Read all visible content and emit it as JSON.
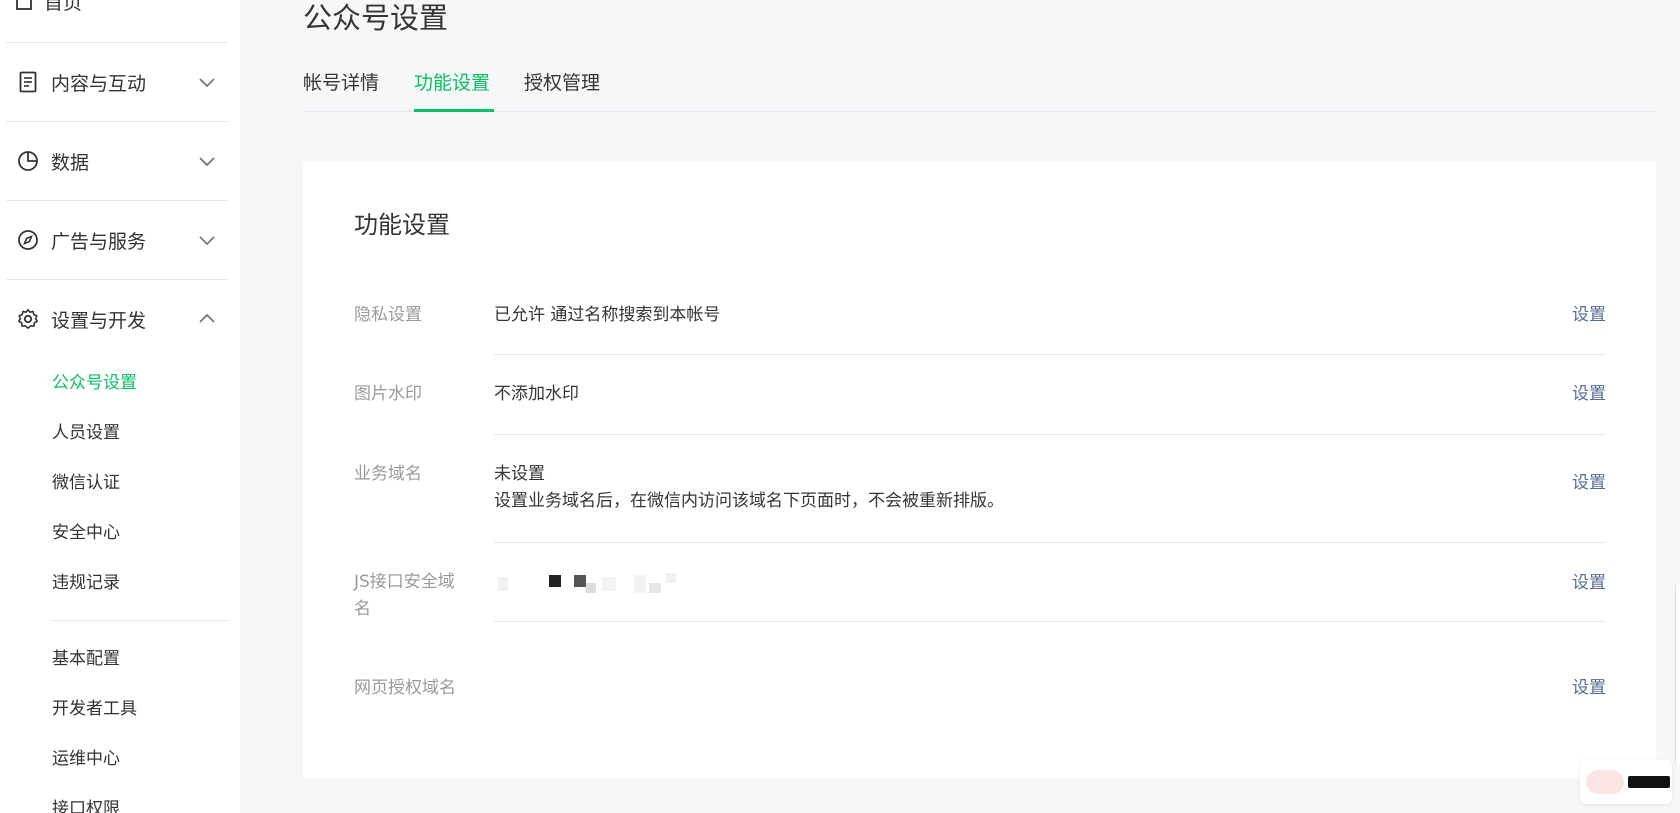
{
  "sidebar": {
    "top_cut_label": "首页",
    "groups": [
      {
        "label": "内容与互动",
        "icon": "document-icon",
        "expanded": false
      },
      {
        "label": "数据",
        "icon": "pie-chart-icon",
        "expanded": false
      },
      {
        "label": "广告与服务",
        "icon": "compass-icon",
        "expanded": false
      },
      {
        "label": "设置与开发",
        "icon": "gear-icon",
        "expanded": true
      }
    ],
    "sub_items": [
      {
        "label": "公众号设置",
        "active": true
      },
      {
        "label": "人员设置"
      },
      {
        "label": "微信认证"
      },
      {
        "label": "安全中心"
      },
      {
        "label": "违规记录"
      },
      {
        "label": "基本配置"
      },
      {
        "label": "开发者工具"
      },
      {
        "label": "运维中心"
      },
      {
        "label": "接口权限"
      }
    ]
  },
  "page_title": "公众号设置",
  "tabs": [
    {
      "label": "帐号详情"
    },
    {
      "label": "功能设置",
      "active": true
    },
    {
      "label": "授权管理"
    }
  ],
  "card": {
    "title": "功能设置",
    "rows": [
      {
        "label": "隐私设置",
        "value": "已允许 通过名称搜索到本帐号",
        "action": "设置"
      },
      {
        "label": "图片水印",
        "value": "不添加水印",
        "action": "设置"
      },
      {
        "label": "业务域名",
        "value": "未设置",
        "note": "设置业务域名后，在微信内访问该域名下页面时，不会被重新排版。",
        "action": "设置"
      },
      {
        "label_line1": "JS接口安全域",
        "label_line2": "名",
        "value": "",
        "action": "设置"
      },
      {
        "label": "网页授权域名",
        "value": "",
        "action": "设置"
      }
    ]
  },
  "colors": {
    "accent": "#07c160",
    "link": "#576b95",
    "muted": "#9a9a9a",
    "background": "#f6f7f9"
  }
}
